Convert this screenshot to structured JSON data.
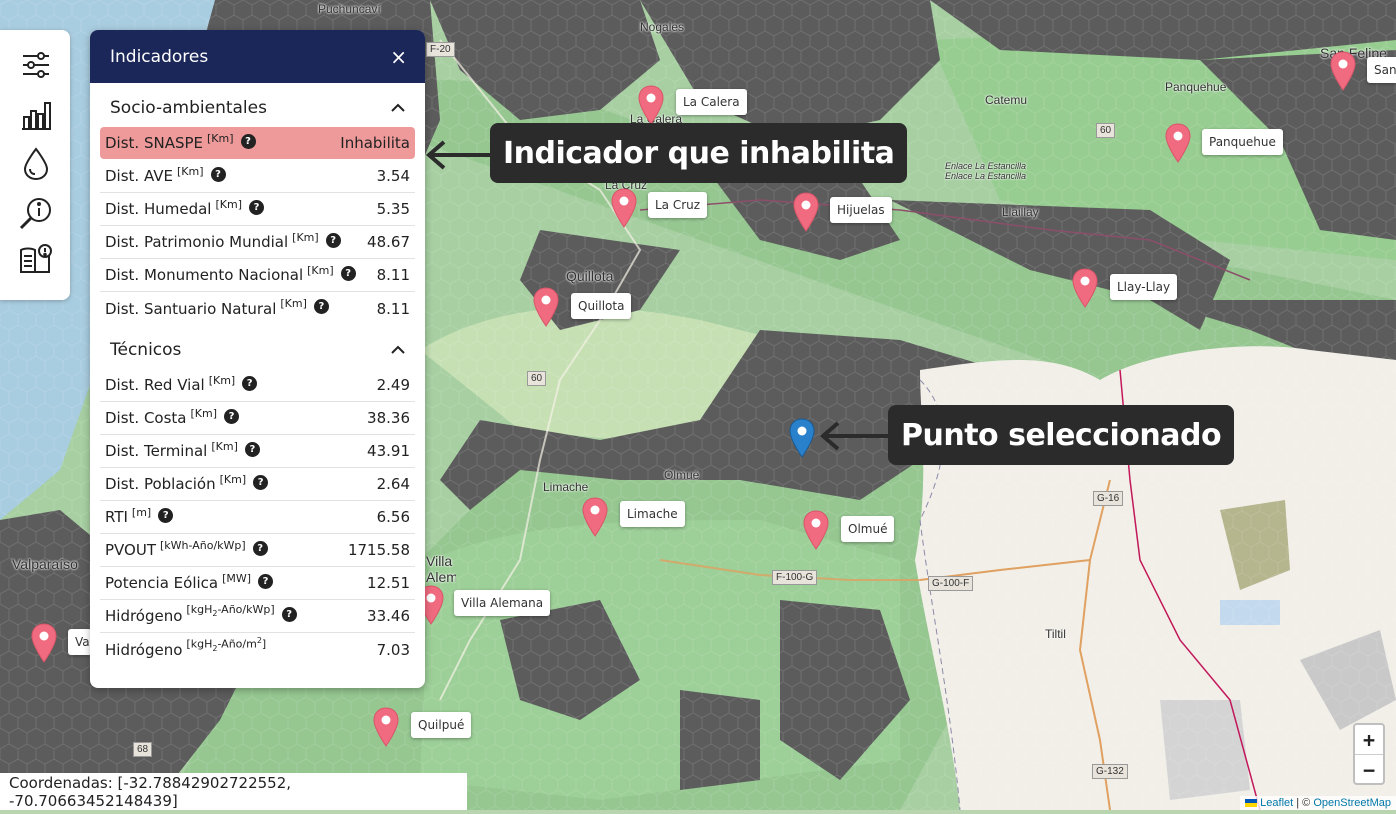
{
  "sidebar": {
    "items": [
      {
        "icon": "sliders-icon"
      },
      {
        "icon": "bar-chart-icon"
      },
      {
        "icon": "water-drop-icon"
      },
      {
        "icon": "search-info-icon"
      },
      {
        "icon": "book-info-icon"
      }
    ]
  },
  "panel": {
    "title": "Indicadores",
    "close_label": "×",
    "sections": [
      {
        "title": "Socio-ambientales",
        "rows": [
          {
            "name": "Dist. SNASPE",
            "unit": "[Km]",
            "value": "Inhabilita",
            "alert": true
          },
          {
            "name": "Dist. AVE",
            "unit": "[Km]",
            "value": "3.54"
          },
          {
            "name": "Dist. Humedal",
            "unit": "[Km]",
            "value": "5.35"
          },
          {
            "name": "Dist. Patrimonio Mundial",
            "unit": "[Km]",
            "value": "48.67"
          },
          {
            "name": "Dist. Monumento Nacional",
            "unit": "[Km]",
            "value": "8.11"
          },
          {
            "name": "Dist. Santuario Natural",
            "unit": "[Km]",
            "value": "8.11"
          }
        ]
      },
      {
        "title": "Técnicos",
        "rows": [
          {
            "name": "Dist. Red Vial",
            "unit": "[Km]",
            "value": "2.49"
          },
          {
            "name": "Dist. Costa",
            "unit": "[Km]",
            "value": "38.36"
          },
          {
            "name": "Dist. Terminal",
            "unit": "[Km]",
            "value": "43.91"
          },
          {
            "name": "Dist. Población",
            "unit": "[Km]",
            "value": "2.64"
          },
          {
            "name": "RTI",
            "unit": "[m]",
            "value": "6.56"
          },
          {
            "name": "PVOUT",
            "unit": "[kWh-Año/kWp]",
            "value": "1715.58"
          },
          {
            "name": "Potencia Eólica",
            "unit": "[MW]",
            "value": "12.51"
          },
          {
            "name": "Hidrógeno",
            "unit_pre": "[kgH",
            "unit_sub": "2",
            "unit_post": "-Año/kWp]",
            "value": "33.46"
          },
          {
            "name": "Hidrógeno",
            "unit_pre": "[kgH",
            "unit_sub": "2",
            "unit_mid": "-Año/m",
            "unit_sup": "2",
            "unit_post": "]",
            "value": "7.03"
          }
        ]
      }
    ],
    "help_glyph": "?"
  },
  "callouts": {
    "indicator": "Indicador que inhabilita",
    "point": "Punto seleccionado"
  },
  "map": {
    "towns": [
      "Puchuncaví",
      "Nogales",
      "La Calera",
      "Catemu",
      "San Felipe",
      "Panquehue",
      "La Cruz",
      "Quillota",
      "Llaillay",
      "Limache",
      "Olmué",
      "Tiltil",
      "Valparaíso",
      "Villa Alemana",
      "Enlace La Estancilla",
      "Enlace La Estancilla"
    ],
    "markers": [
      {
        "label": "La Calera"
      },
      {
        "label": "La Cruz"
      },
      {
        "label": "Hijuelas"
      },
      {
        "label": "Quillota"
      },
      {
        "label": "Panquehue"
      },
      {
        "label": "Llay-Llay"
      },
      {
        "label": "Limache"
      },
      {
        "label": "Olmué"
      },
      {
        "label": "Villa Alemana"
      },
      {
        "label": "Quilpué"
      },
      {
        "label": "San"
      },
      {
        "label": "Va"
      }
    ],
    "roads": [
      "F-20",
      "60",
      "60",
      "G-16",
      "G-100-F",
      "F-100-G",
      "G-132",
      "68"
    ],
    "pin_color": "#f06b7f",
    "selected_pin_color": "#2a81cb"
  },
  "coordinates": "Coordenadas: [-32.78842902722552, -70.70663452148439]",
  "zoom": {
    "in": "+",
    "out": "−"
  },
  "attribution": {
    "leaflet": "Leaflet",
    "sep": " | © ",
    "osm": "OpenStreetMap"
  }
}
